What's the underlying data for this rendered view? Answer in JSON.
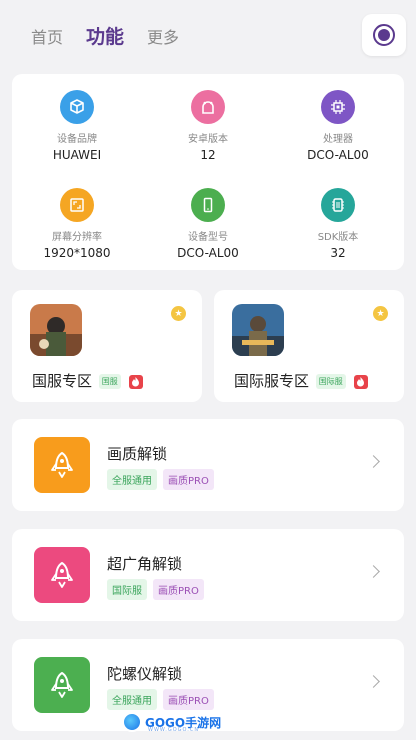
{
  "tabs": [
    {
      "label": "首页"
    },
    {
      "label": "功能"
    },
    {
      "label": "更多"
    }
  ],
  "device_info": [
    {
      "label": "设备品牌",
      "value": "HUAWEI",
      "color": "#3aa0e8",
      "icon": "cube-icon"
    },
    {
      "label": "安卓版本",
      "value": "12",
      "color": "#ec6fa0",
      "icon": "android-icon"
    },
    {
      "label": "处理器",
      "value": "DCO-AL00",
      "color": "#7e56c5",
      "icon": "chip-icon"
    },
    {
      "label": "屏幕分辨率",
      "value": "1920*1080",
      "color": "#f5a623",
      "icon": "screen-icon"
    },
    {
      "label": "设备型号",
      "value": "DCO-AL00",
      "color": "#4cae4f",
      "icon": "phone-icon"
    },
    {
      "label": "SDK版本",
      "value": "32",
      "color": "#26a69a",
      "icon": "sdk-chip-icon"
    }
  ],
  "games": [
    {
      "name": "国服专区",
      "tag": "国服"
    },
    {
      "name": "国际服专区",
      "tag": "国际服"
    }
  ],
  "features": [
    {
      "title": "画质解锁",
      "color": "#f89c1c",
      "tags": [
        "全服通用",
        "画质PRO"
      ]
    },
    {
      "title": "超广角解锁",
      "color": "#ec4a7f",
      "tags": [
        "国际服",
        "画质PRO"
      ]
    },
    {
      "title": "陀螺仪解锁",
      "color": "#4caf50",
      "tags": [
        "全服通用",
        "画质PRO"
      ]
    }
  ],
  "watermark": {
    "brand": "GOGO手游网",
    "domain": "WWW.GOGO.CN"
  }
}
